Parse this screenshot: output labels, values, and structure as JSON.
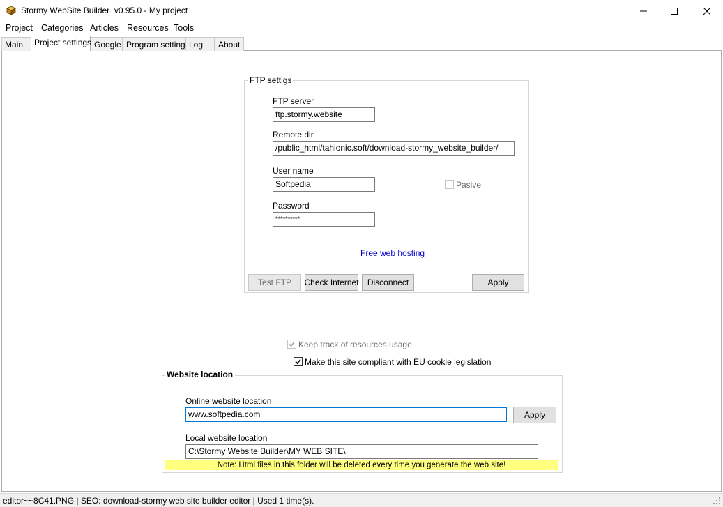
{
  "window": {
    "title": "Stormy WebSite Builder  v0.95.0 - My project",
    "app_icon": "app-box-icon",
    "controls": [
      "minimize-icon",
      "maximize-icon",
      "close-icon"
    ]
  },
  "menu": {
    "items": [
      {
        "label": "Project"
      },
      {
        "label": "Categories"
      },
      {
        "label": "Articles"
      },
      {
        "label": "Resources"
      },
      {
        "label": "Tools"
      }
    ]
  },
  "tabs": [
    {
      "label": "Main",
      "active": false
    },
    {
      "label": "Project settings",
      "active": true
    },
    {
      "label": "Google",
      "active": false
    },
    {
      "label": "Program settings",
      "active": false
    },
    {
      "label": "Log",
      "active": false
    },
    {
      "label": "About",
      "active": false
    }
  ],
  "ftp": {
    "group_title": "FTP settigs",
    "server_label": "FTP server",
    "server_value": "ftp.stormy.website",
    "remote_dir_label": "Remote dir",
    "remote_dir_value": "/public_html/tahionic.soft/download-stormy_website_builder/",
    "username_label": "User name",
    "username_value": "Softpedia",
    "pasive_label": "Pasive",
    "pasive_checked": false,
    "password_label": "Password",
    "password_value": "**********",
    "free_hosting_link": "Free web hosting",
    "buttons": {
      "test_ftp": "Test FTP",
      "check_internet": "Check Internet",
      "disconnect": "Disconnect",
      "apply": "Apply"
    }
  },
  "options": {
    "keep_track_label": "Keep track of resources usage",
    "keep_track_checked": true,
    "eu_cookie_label": "Make this site compliant with EU cookie legislation",
    "eu_cookie_checked": true
  },
  "website_location": {
    "group_title": "Website location",
    "online_label": "Online website location",
    "online_value": "www.softpedia.com",
    "apply_label": "Apply",
    "local_label": "Local website location",
    "local_value": "C:\\Stormy Website Builder\\MY WEB SITE\\",
    "note": "Note: Html files in this folder will be deleted every time you generate the web site!"
  },
  "status": {
    "text": "editor~~8C41.PNG | SEO: download-stormy web site builder editor | Used 1 time(s)."
  },
  "colors": {
    "link": "#0000cc",
    "note_bg": "#ffff80",
    "focus_border": "#0078d7"
  }
}
